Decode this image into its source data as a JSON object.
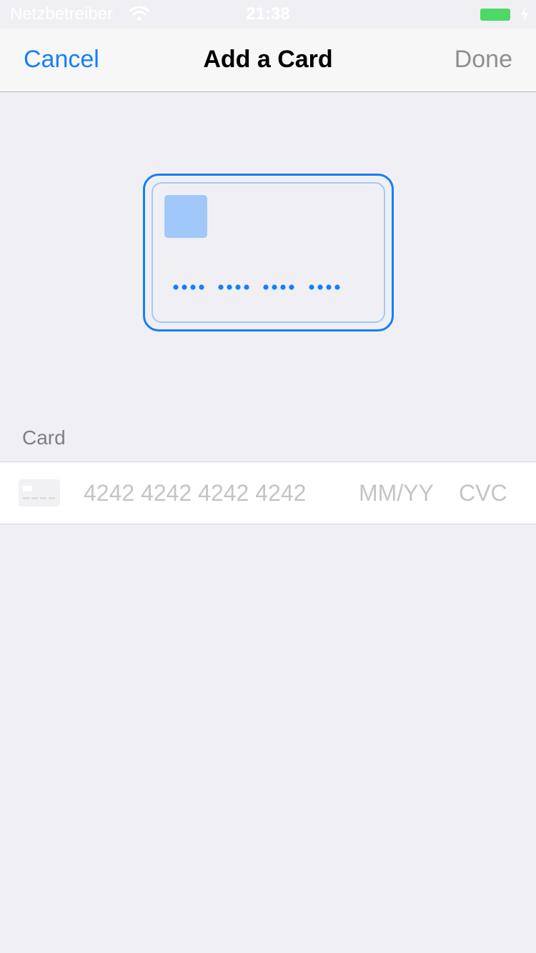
{
  "status_bar": {
    "carrier": "Netzbetreiber",
    "time": "21:38",
    "icons": [
      "wifi-icon",
      "battery-icon",
      "charging-icon"
    ],
    "battery_color": "#4cd964"
  },
  "nav": {
    "cancel_label": "Cancel",
    "title": "Add a Card",
    "done_label": "Done"
  },
  "card_preview": {
    "number_mask": "•••• •••• •••• ••••"
  },
  "form": {
    "section_header": "Card",
    "brand_icon": "generic-card-icon",
    "number_placeholder": "4242 4242 4242 4242",
    "expiry_placeholder": "MM/YY",
    "cvc_placeholder": "CVC"
  },
  "colors": {
    "accent": "#157efb",
    "disabled": "#8e8e93",
    "placeholder": "#c4c4c8",
    "background": "#f0f0f4"
  }
}
